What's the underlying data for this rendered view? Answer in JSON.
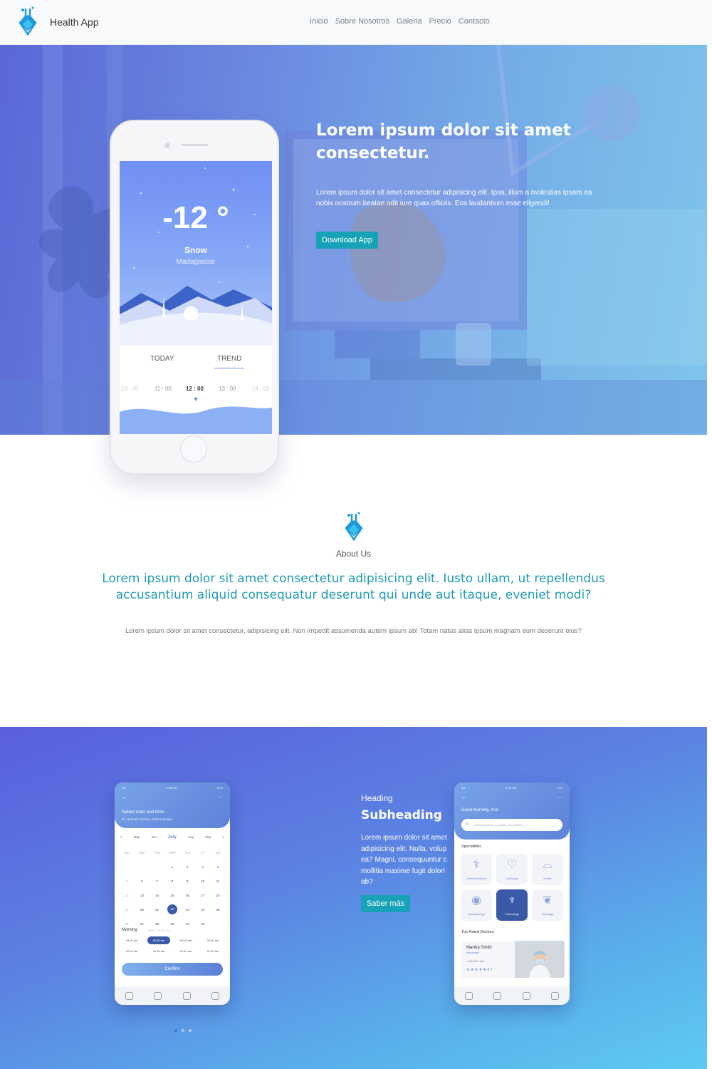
{
  "nav": {
    "brand": "Health App",
    "links": [
      "Inicio",
      "Sobre Nosotros",
      "Galeria",
      "Precio",
      "Contacto"
    ]
  },
  "hero": {
    "title": "Lorem ipsum dolor sit amet consectetur.",
    "text": "Lorem ipsum dolor sit amet consectetur adipisicing elit. Ipsa, illum a molestias ipsam ea nobis nostrum beatae odit iure quas officiis. Eos laudantium esse eligendi!",
    "button": "Download App"
  },
  "weather_phone": {
    "temperature": "-12 °",
    "condition": "Snow",
    "location": "Madagascar",
    "tab_today": "TODAY",
    "tab_trend": "TREND",
    "times": [
      "10 : 00",
      "11 : 00",
      "12 : 00",
      "13 : 00",
      "14 : 00"
    ]
  },
  "about": {
    "label": "About Us",
    "heading": "Lorem ipsum dolor sit amet consectetur adipisicing elit. Iusto ullam, ut repellendus accusantium aliquid consequatur deserunt qui unde aut itaque, eveniet modi?",
    "text": "Lorem ipsum dolor sit amet consectetur, adipisicing elit. Non impedit assumenda autem ipsum ab! Totam natus alias ipsum magnam eum deserunt eius?"
  },
  "feature": {
    "heading": "Heading",
    "subheading": "Subheading",
    "text": [
      "Lorem ipsum dolor sit amet",
      "adipisicing elit. Nulla, volup",
      "ea? Magni, consequuntur c",
      "mollitia maxime fugit dolori",
      "ab?"
    ],
    "button": "Saber más"
  },
  "calendar_phone": {
    "status_left": "4G",
    "status_time": "4:20 PM",
    "status_right": "67%",
    "title": "Select date and time",
    "subtitle": "Dr. Hannah Franklin, Pulmonologist",
    "months": [
      "<",
      "May",
      "Jun",
      "July",
      "Aug",
      "Sep",
      ">"
    ],
    "weekdays": [
      "Sun",
      "Mon",
      "Tue",
      "Wed",
      "Thu",
      "Fri",
      "Sat"
    ],
    "weeks": [
      [
        "",
        "",
        "",
        "1",
        "2",
        "3",
        "4"
      ],
      [
        "5",
        "6",
        "7",
        "8",
        "9",
        "10",
        "11"
      ],
      [
        "12",
        "13",
        "14",
        "15",
        "16",
        "17",
        "18"
      ],
      [
        "19",
        "20",
        "21",
        "22",
        "23",
        "24",
        "25"
      ],
      [
        "26",
        "27",
        "28",
        "29",
        "30",
        "31",
        ""
      ]
    ],
    "selected_day": "22",
    "morning_label": "Morning",
    "morning_range": "08:00 - 11:30 am",
    "slots": [
      "08:00 am",
      "08:30 am",
      "09:00 am",
      "09:30 am",
      "10:00 am",
      "10:30 am",
      "11:00 am",
      "11:30 am"
    ],
    "selected_slot": "08:30 am",
    "confirm": "Confirm"
  },
  "doctors_phone": {
    "status_left": "4G",
    "status_time": "4:20 PM",
    "status_right": "67%",
    "greeting": "Good morning, Ana",
    "search_placeholder": "Search doctors, hospitals, specialities...",
    "specialities_label": "Specialities",
    "specialities": [
      "General Medicine",
      "Cardiology",
      "Dentist",
      "Ophthalmology",
      "Pneumology",
      "Neurology"
    ],
    "active_speciality": "Pneumology",
    "top_rated_label": "Top Rated Doctors",
    "doctor_name": "Martha Smith",
    "doctor_role": "Neurologist",
    "doctor_location": "NW, New York",
    "doctor_rating": "★ ★ ★ ★ ★ 4.7"
  },
  "carousel": {
    "slides": 3,
    "active": 1
  },
  "colors": {
    "teal": "#17a2b8",
    "heading_teal": "#1f99b0",
    "hero_start": "#5a67d6",
    "hero_end": "#7fc6ec",
    "feature_start": "#5a5fdb",
    "feature_end": "#5ccaf3"
  }
}
